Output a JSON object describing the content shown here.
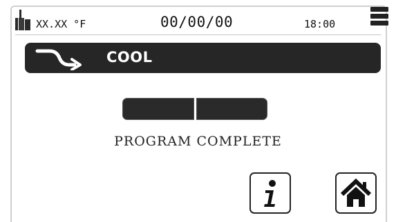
{
  "header": {
    "temperature": "XX.XX °F",
    "date": "00/00/00",
    "time": "18:00",
    "icons": {
      "thermometer": "thermometer-icon",
      "menu": "hamburger-menu-icon"
    }
  },
  "status": {
    "label": "COOL",
    "icon": "curved-arrow-right-icon"
  },
  "progress": {
    "segments_filled": 2,
    "segments_total": 2
  },
  "message": "PROGRAM COMPLETE",
  "buttons": {
    "info_icon": "info-icon",
    "home_icon": "home-icon"
  },
  "colors": {
    "bar_background": "#262626",
    "text": "#111111",
    "background": "#ffffff"
  }
}
